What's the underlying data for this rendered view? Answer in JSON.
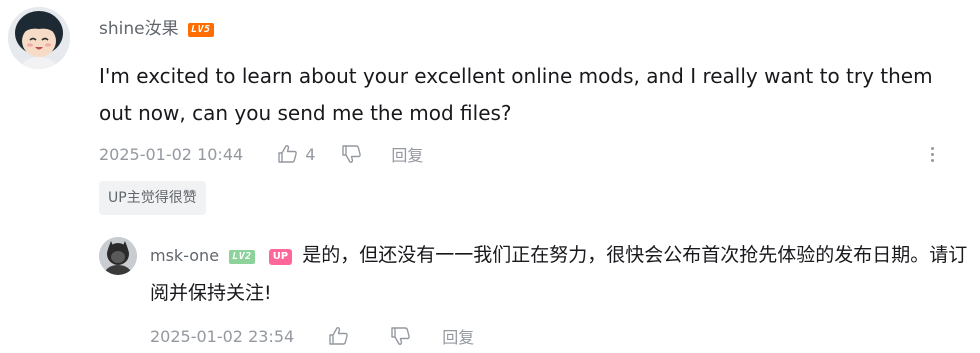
{
  "comment": {
    "username": "shine汝果",
    "level": "LV5",
    "text": "I'm excited to learn about your excellent online mods, and I really want to try them out now, can you send me the mod files?",
    "time": "2025-01-02 10:44",
    "likes": "4",
    "reply_label": "回复",
    "up_tag": "UP主觉得很赞"
  },
  "reply": {
    "username": "msk-one",
    "level": "LV2",
    "up_badge": "UP",
    "text": "是的，但还没有一一我们正在努力，很快会公布首次抢先体验的发布日期。请订阅并保持关注!",
    "time": "2025-01-02 23:54",
    "reply_label": "回复"
  },
  "icons": {
    "like": "thumbs-up-icon",
    "dislike": "thumbs-down-icon",
    "more": "more-vertical-icon"
  },
  "colors": {
    "level5": "#ff6c00",
    "level2": "#8bd29b",
    "up_badge": "#ff6699",
    "meta_text": "#9499a0"
  }
}
